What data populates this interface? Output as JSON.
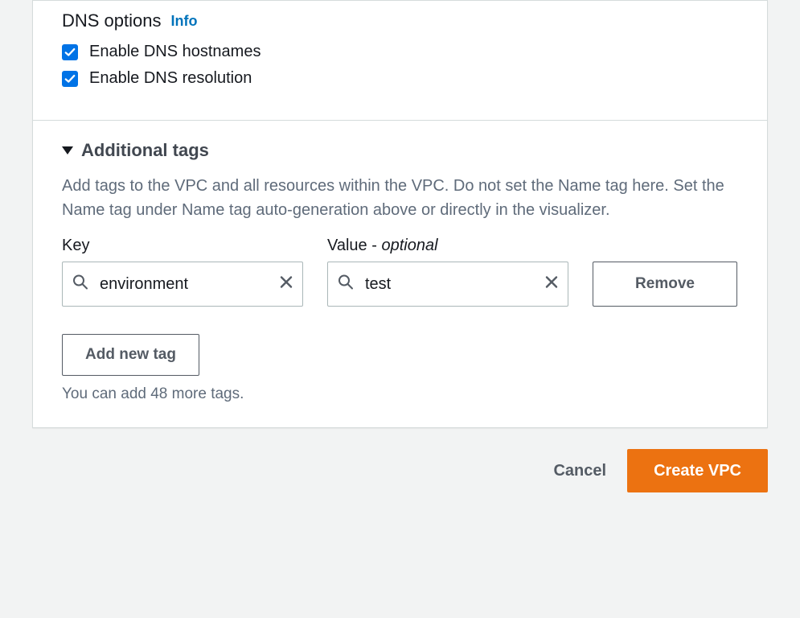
{
  "dns": {
    "title": "DNS options",
    "info": "Info",
    "hostnames_label": "Enable DNS hostnames",
    "resolution_label": "Enable DNS resolution"
  },
  "tags": {
    "header": "Additional tags",
    "description": "Add tags to the VPC and all resources within the VPC. Do not set the Name tag here. Set the Name tag under Name tag auto-generation above or directly in the visualizer.",
    "key_label": "Key",
    "value_label_prefix": "Value - ",
    "value_label_optional": "optional",
    "rows": [
      {
        "key": "environment",
        "value": "test"
      }
    ],
    "remove_label": "Remove",
    "add_label": "Add new tag",
    "hint": "You can add 48 more tags."
  },
  "footer": {
    "cancel": "Cancel",
    "create": "Create VPC"
  }
}
